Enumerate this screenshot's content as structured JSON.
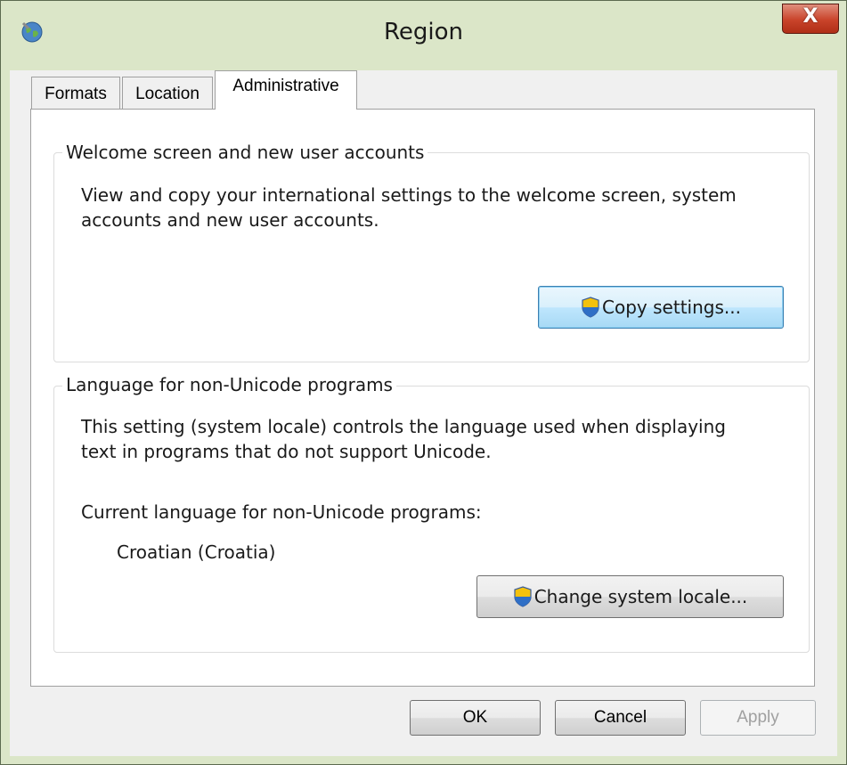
{
  "window": {
    "title": "Region",
    "close_label": "X"
  },
  "tabs": [
    {
      "label": "Formats",
      "active": false
    },
    {
      "label": "Location",
      "active": false
    },
    {
      "label": "Administrative",
      "active": true
    }
  ],
  "welcome_group": {
    "title": "Welcome screen and new user accounts",
    "description_line1": "View and copy your international settings to the welcome screen, system",
    "description_line2": "accounts and new user accounts.",
    "copy_button": "Copy settings..."
  },
  "language_group": {
    "title": "Language for non-Unicode programs",
    "description_line1": "This setting (system locale) controls the language used when displaying",
    "description_line2": "text in programs that do not support Unicode.",
    "current_label": "Current language for non-Unicode programs:",
    "current_value": "Croatian (Croatia)",
    "change_button": "Change system locale..."
  },
  "buttons": {
    "ok": "OK",
    "cancel": "Cancel",
    "apply": "Apply"
  },
  "icons": {
    "window_icon": "globe-icon",
    "shield_icon": "uac-shield-icon"
  },
  "colors": {
    "frame": "#dbe6c8",
    "close": "#c9432a",
    "default_button_border": "#3c7fb1"
  }
}
